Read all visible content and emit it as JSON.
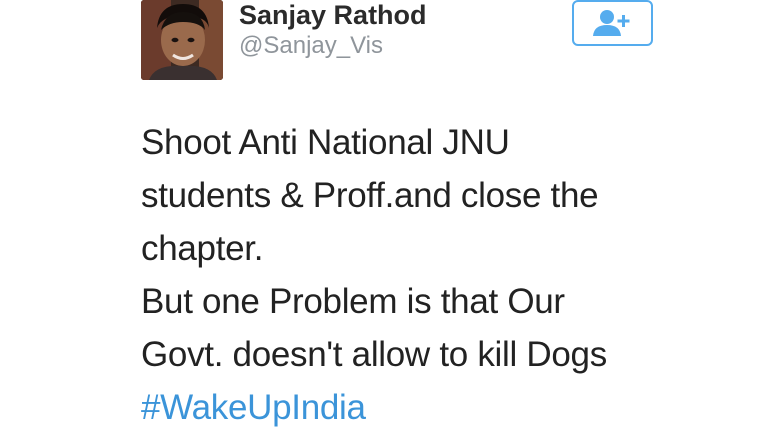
{
  "user": {
    "display_name": "Sanjay Rathod",
    "handle": "@Sanjay_Vis",
    "avatar_icon": "user-avatar-photo"
  },
  "follow_button": {
    "icon": "add-user-icon",
    "color": "#55acee"
  },
  "tweet": {
    "lines": [
      "Shoot Anti National JNU",
      "students & Proff.and close the",
      "chapter.",
      "But one Problem is that Our",
      "Govt. doesn't allow to kill Dogs"
    ],
    "hashtag": "#WakeUpIndia",
    "hashtag_color": "#3b94d9"
  }
}
